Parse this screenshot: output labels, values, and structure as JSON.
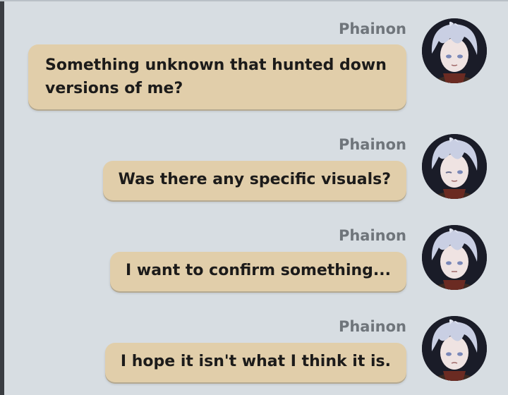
{
  "messages": [
    {
      "sender": "Phainon",
      "text": "Something unknown that hunted down versions of me?"
    },
    {
      "sender": "Phainon",
      "text": "Was there any specific visuals?"
    },
    {
      "sender": "Phainon",
      "text": "I want to confirm something..."
    },
    {
      "sender": "Phainon",
      "text": "I hope it isn't what I think it is."
    }
  ],
  "colors": {
    "background": "#d7dde2",
    "bubble": "#e1ceaa",
    "sender_name": "#6f757b",
    "message_text": "#1c1b1a"
  },
  "icons": {
    "avatar": "character-avatar-icon"
  }
}
